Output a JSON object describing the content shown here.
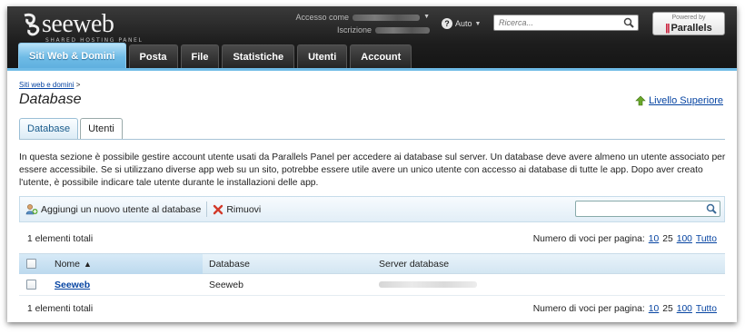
{
  "header": {
    "logo_text": "seeweb",
    "logo_subtitle": "SHARED HOSTING PANEL",
    "account_label": "Accesso come",
    "subscription_label": "Iscrizione",
    "help_label": "Auto",
    "search_placeholder": "Ricerca...",
    "powered_by": "Powered by",
    "powered_brand": "Parallels"
  },
  "tabs": [
    {
      "label": "Siti Web & Domini",
      "active": true
    },
    {
      "label": "Posta"
    },
    {
      "label": "File"
    },
    {
      "label": "Statistiche"
    },
    {
      "label": "Utenti"
    },
    {
      "label": "Account"
    }
  ],
  "breadcrumb": {
    "link": "Siti web e domini",
    "sep": ">"
  },
  "page_title": "Database",
  "up_link": "Livello Superiore",
  "subtabs": [
    {
      "label": "Database"
    },
    {
      "label": "Utenti",
      "active": true
    }
  ],
  "description": "In questa sezione è possibile gestire account utente usati da Parallels Panel per accedere ai database sul server. Un database deve avere almeno un utente associato per essere accessibile. Se si utilizzano diverse app web su un sito, potrebbe essere utile avere un unico utente con accesso ai database di tutte le app. Dopo aver creato l'utente, è possibile indicare tale utente durante le installazioni delle app.",
  "toolbar": {
    "add_label": "Aggiungi un nuovo utente al database",
    "remove_label": "Rimuovi"
  },
  "totals_text": "1 elementi totali",
  "per_page": {
    "label": "Numero di voci per pagina:",
    "options": [
      "10",
      "25",
      "100",
      "Tutto"
    ]
  },
  "table": {
    "columns": [
      "Nome",
      "Database",
      "Server database"
    ],
    "rows": [
      {
        "name": "Seeweb",
        "database": "Seeweb"
      }
    ]
  },
  "colors": {
    "accent": "#6fbbe6",
    "link": "#0644a2",
    "header_bg": "#1d1d1d"
  }
}
